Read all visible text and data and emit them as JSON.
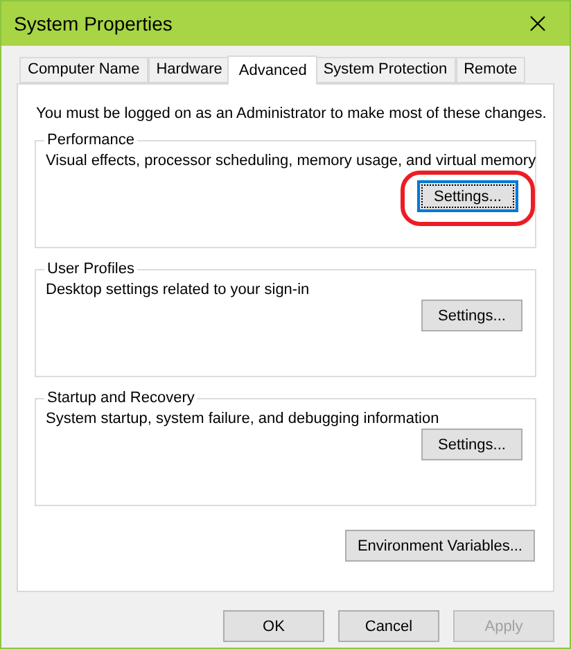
{
  "window": {
    "title": "System Properties"
  },
  "tabs": [
    {
      "label": "Computer Name",
      "selected": false
    },
    {
      "label": "Hardware",
      "selected": false
    },
    {
      "label": "Advanced",
      "selected": true
    },
    {
      "label": "System Protection",
      "selected": false
    },
    {
      "label": "Remote",
      "selected": false
    }
  ],
  "notice": "You must be logged on as an Administrator to make most of these changes.",
  "groups": [
    {
      "title": "Performance",
      "description": "Visual effects, processor scheduling, memory usage, and virtual memory",
      "button": {
        "label": "Settings...",
        "focused": true,
        "highlighted": true
      }
    },
    {
      "title": "User Profiles",
      "description": "Desktop settings related to your sign-in",
      "button": {
        "label": "Settings...",
        "focused": false,
        "highlighted": false
      }
    },
    {
      "title": "Startup and Recovery",
      "description": "System startup, system failure, and debugging information",
      "button": {
        "label": "Settings...",
        "focused": false,
        "highlighted": false
      }
    }
  ],
  "environment_button": {
    "label": "Environment Variables..."
  },
  "footer_buttons": [
    {
      "label": "OK",
      "disabled": false
    },
    {
      "label": "Cancel",
      "disabled": false
    },
    {
      "label": "Apply",
      "disabled": true
    }
  ]
}
